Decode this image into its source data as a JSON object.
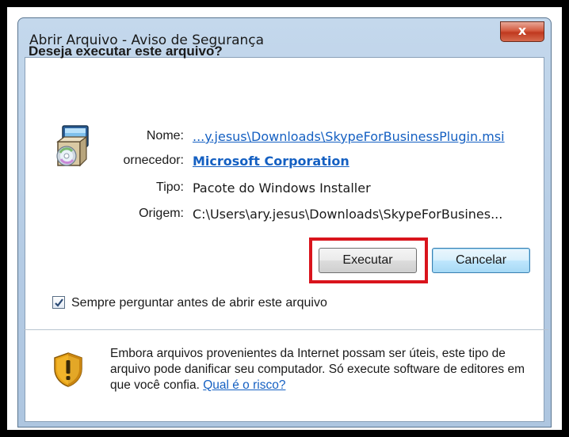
{
  "window": {
    "title": "Abrir Arquivo - Aviso de Segurança",
    "close_label": "x"
  },
  "question": "Deseja executar este arquivo?",
  "icons": {
    "installer": "windows-installer-package-icon",
    "shield": "security-warning-shield-icon",
    "checkmark": "checkmark-icon"
  },
  "properties": {
    "name_label": "Nome:",
    "name_value": "...y.jesus\\Downloads\\SkypeForBusinessPlugin.msi",
    "publisher_label": "ornecedor:",
    "publisher_value": "Microsoft Corporation",
    "type_label": "Tipo:",
    "type_value": "Pacote do Windows Installer",
    "origin_label": "Origem:",
    "origin_value": "C:\\Users\\ary.jesus\\Downloads\\SkypeForBusines..."
  },
  "buttons": {
    "run_label": "Executar",
    "cancel_label": "Cancelar"
  },
  "checkbox": {
    "label": "Sempre perguntar antes de abrir este arquivo",
    "checked": true
  },
  "warning": {
    "text": "Embora arquivos provenientes da Internet possam ser úteis, este tipo de arquivo pode danificar seu computador. Só execute software de editores em que você confia.",
    "link": "Qual é o risco?"
  },
  "colors": {
    "highlight": "#d9141c",
    "link": "#1560c2",
    "close_button": "#c0391f"
  }
}
